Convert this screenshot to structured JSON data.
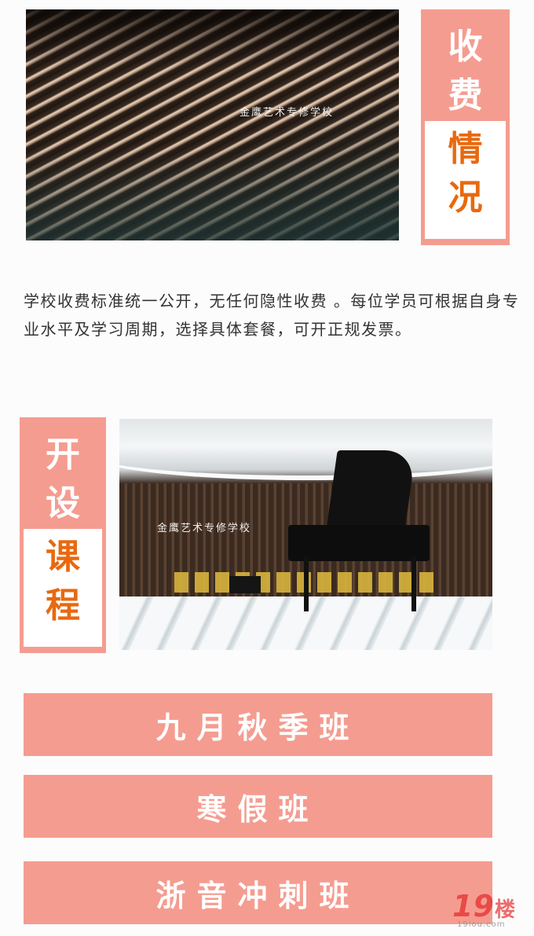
{
  "fees_section": {
    "title_chars_top": [
      "收",
      "费"
    ],
    "title_chars_bottom": [
      "情",
      "况"
    ],
    "photo_watermark": "金鹰艺术专修学校",
    "description": "学校收费标准统一公开，无任何隐性收费 。每位学员可根据自身专业水平及学习周期，选择具体套餐，可开正规发票。"
  },
  "courses_section": {
    "title_chars_top": [
      "开",
      "设"
    ],
    "title_chars_bottom": [
      "课",
      "程"
    ],
    "photo_watermark": "金鹰艺术专修学校",
    "items": [
      "九月秋季班",
      "寒假班",
      "浙音冲刺班"
    ]
  },
  "corner_logo": {
    "number": "19",
    "char": "楼",
    "url": "19lou.com"
  },
  "colors": {
    "accent_pink": "#f59c90",
    "accent_orange": "#e8690f"
  }
}
